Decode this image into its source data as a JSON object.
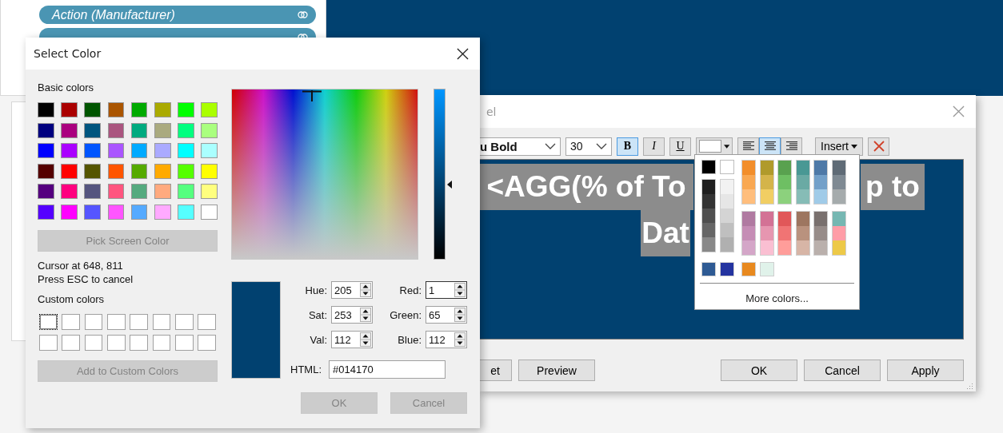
{
  "background": {
    "pills": [
      {
        "kind": "labelled",
        "label": "Action (Manufacturer)"
      },
      {
        "kind": "covered"
      }
    ]
  },
  "edit_label_dialog": {
    "title": "el",
    "font": "u Bold",
    "size": "30",
    "format_buttons": [
      {
        "label": "B",
        "selected": true
      },
      {
        "label": "I",
        "selected": false
      },
      {
        "label": "U",
        "selected": false
      }
    ],
    "text_color": {
      "color": "#ffffff"
    },
    "align_buttons": [
      {
        "kind": "left",
        "selected": false
      },
      {
        "kind": "center",
        "selected": true
      },
      {
        "kind": "right",
        "selected": false
      }
    ],
    "insert": "Insert",
    "text_lines": [
      [
        "<AGG(% of To",
        "p to"
      ],
      [
        "Dat"
      ]
    ],
    "left_buttons": [
      "et",
      "Preview"
    ],
    "right_buttons": [
      "OK",
      "Cancel",
      "Apply"
    ]
  },
  "palette": {
    "top": [
      {
        "color": "#000000"
      },
      {
        "color": "#ffffff"
      }
    ],
    "grays": [
      [
        {
          "color": "#1f1f1f"
        },
        {
          "color": "#333333"
        },
        {
          "color": "#4f4f4f"
        },
        {
          "color": "#666666"
        },
        {
          "color": "#888888"
        }
      ],
      [
        {
          "color": "#f2f2f2"
        },
        {
          "color": "#e6e6e6"
        },
        {
          "color": "#d4d4d4"
        },
        {
          "color": "#bfbfbf"
        },
        {
          "color": "#b0b0b0"
        }
      ]
    ],
    "upper": [
      [
        {
          "color": "#f28e2b"
        },
        {
          "color": "#f9a852"
        },
        {
          "color": "#ffbe7d"
        }
      ],
      [
        {
          "color": "#b09a2b"
        },
        {
          "color": "#d4b44a"
        },
        {
          "color": "#f1ce63"
        }
      ],
      [
        {
          "color": "#59a14f"
        },
        {
          "color": "#6ebf63"
        },
        {
          "color": "#8cd17d"
        }
      ],
      [
        {
          "color": "#499894"
        },
        {
          "color": "#6aaaa4"
        },
        {
          "color": "#86bcb6"
        }
      ],
      [
        {
          "color": "#4e79a7"
        },
        {
          "color": "#73a0c9"
        },
        {
          "color": "#a0cbe8"
        }
      ],
      [
        {
          "color": "#5f6b76"
        },
        {
          "color": "#7f8a93"
        },
        {
          "color": "#a5abac"
        }
      ]
    ],
    "lower": [
      [
        {
          "color": "#b07aa1"
        },
        {
          "color": "#c58db5"
        },
        {
          "color": "#d4a6c8"
        }
      ],
      [
        {
          "color": "#d37295"
        },
        {
          "color": "#e696b0"
        },
        {
          "color": "#fabfd2"
        }
      ],
      [
        {
          "color": "#e15759"
        },
        {
          "color": "#f07474"
        },
        {
          "color": "#ff9d9a"
        }
      ],
      [
        {
          "color": "#9d7660"
        },
        {
          "color": "#b9927e"
        },
        {
          "color": "#d7b5a6"
        }
      ],
      [
        {
          "color": "#79706e"
        },
        {
          "color": "#978c89"
        },
        {
          "color": "#bab0ac"
        }
      ],
      [
        {
          "color": "#76b7b2"
        },
        {
          "color": "#ff9da7"
        },
        {
          "color": "#edc948"
        }
      ]
    ],
    "recent": [
      {
        "color": "#2e5a93"
      },
      {
        "color": "#2434a0"
      },
      {
        "color": "#e8891f"
      },
      {
        "color": "#e0f2ea"
      }
    ],
    "more": "More colors..."
  },
  "select_color_dialog": {
    "title": "Select Color",
    "basic_label": "Basic colors",
    "basic_colors": [
      {
        "color": "#000000"
      },
      {
        "color": "#aa0000"
      },
      {
        "color": "#005500"
      },
      {
        "color": "#aa5500"
      },
      {
        "color": "#00aa00"
      },
      {
        "color": "#aaaa00"
      },
      {
        "color": "#00ff00"
      },
      {
        "color": "#aaff00"
      },
      {
        "color": "#00007f"
      },
      {
        "color": "#aa007f"
      },
      {
        "color": "#00557f"
      },
      {
        "color": "#aa557f"
      },
      {
        "color": "#00aa7f"
      },
      {
        "color": "#aaaa7f"
      },
      {
        "color": "#00ff7f"
      },
      {
        "color": "#aaff7f"
      },
      {
        "color": "#0000ff"
      },
      {
        "color": "#aa00ff"
      },
      {
        "color": "#0055ff"
      },
      {
        "color": "#aa55ff"
      },
      {
        "color": "#00aaff"
      },
      {
        "color": "#aaaaff"
      },
      {
        "color": "#00ffff"
      },
      {
        "color": "#aaffff"
      },
      {
        "color": "#550000"
      },
      {
        "color": "#ff0000"
      },
      {
        "color": "#555500"
      },
      {
        "color": "#ff5500"
      },
      {
        "color": "#55aa00"
      },
      {
        "color": "#ffaa00"
      },
      {
        "color": "#55ff00"
      },
      {
        "color": "#ffff00"
      },
      {
        "color": "#55007f"
      },
      {
        "color": "#ff007f"
      },
      {
        "color": "#55557f"
      },
      {
        "color": "#ff557f"
      },
      {
        "color": "#55aa7f"
      },
      {
        "color": "#ffaa7f"
      },
      {
        "color": "#55ff7f"
      },
      {
        "color": "#ffff7f"
      },
      {
        "color": "#5500ff"
      },
      {
        "color": "#ff00ff"
      },
      {
        "color": "#5555ff"
      },
      {
        "color": "#ff55ff"
      },
      {
        "color": "#55aaff"
      },
      {
        "color": "#ffaaff"
      },
      {
        "color": "#55ffff"
      },
      {
        "color": "#ffffff"
      }
    ],
    "pick_button": {
      "label": "Pick Screen Color",
      "disabled": true
    },
    "cursor_text": "Cursor at 648, 811",
    "esc_text": "Press ESC to cancel",
    "custom_label": "Custom colors",
    "custom_colors": [
      {
        "color": "#ffffff",
        "selected": true
      },
      {
        "color": "#ffffff",
        "selected": false
      },
      {
        "color": "#ffffff",
        "selected": false
      },
      {
        "color": "#ffffff",
        "selected": false
      },
      {
        "color": "#ffffff",
        "selected": false
      },
      {
        "color": "#ffffff",
        "selected": false
      },
      {
        "color": "#ffffff",
        "selected": false
      },
      {
        "color": "#ffffff",
        "selected": false
      },
      {
        "color": "#ffffff",
        "selected": false
      },
      {
        "color": "#ffffff",
        "selected": false
      },
      {
        "color": "#ffffff",
        "selected": false
      },
      {
        "color": "#ffffff",
        "selected": false
      },
      {
        "color": "#ffffff",
        "selected": false
      },
      {
        "color": "#ffffff",
        "selected": false
      },
      {
        "color": "#ffffff",
        "selected": false
      },
      {
        "color": "#ffffff",
        "selected": false
      }
    ],
    "add_button": {
      "label": "Add to Custom Colors",
      "disabled": true
    },
    "value_slider": {
      "level": 0.44
    },
    "preview": {
      "color": "#014170"
    },
    "fields": [
      {
        "label": "Hue:",
        "value": "205",
        "focused": false
      },
      {
        "label": "Red:",
        "value": "1",
        "focused": true
      },
      {
        "label": "Sat:",
        "value": "253",
        "focused": false
      },
      {
        "label": "Green:",
        "value": "65",
        "focused": false
      },
      {
        "label": "Val:",
        "value": "112",
        "focused": false
      },
      {
        "label": "Blue:",
        "value": "112",
        "focused": false
      }
    ],
    "html_label": "HTML:",
    "html_value": "#014170",
    "buttons": [
      {
        "label": "OK",
        "disabled": true
      },
      {
        "label": "Cancel",
        "disabled": true
      }
    ]
  }
}
